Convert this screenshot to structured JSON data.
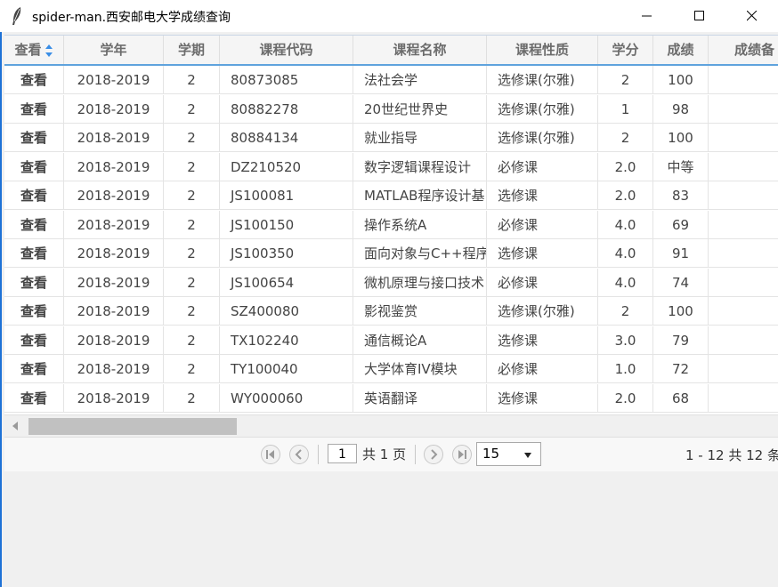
{
  "window": {
    "title": "spider-man.西安邮电大学成绩查询",
    "icon": "feather-icon"
  },
  "table": {
    "columns": [
      "查看",
      "学年",
      "学期",
      "课程代码",
      "课程名称",
      "课程性质",
      "学分",
      "成绩",
      "成绩备"
    ],
    "rows": [
      {
        "view": "查看",
        "year": "2018-2019",
        "term": "2",
        "code": "80873085",
        "name": "法社会学",
        "type": "选修课(尔雅)",
        "credit": "2",
        "score": "100"
      },
      {
        "view": "查看",
        "year": "2018-2019",
        "term": "2",
        "code": "80882278",
        "name": "20世纪世界史",
        "type": "选修课(尔雅)",
        "credit": "1",
        "score": "98"
      },
      {
        "view": "查看",
        "year": "2018-2019",
        "term": "2",
        "code": "80884134",
        "name": "就业指导",
        "type": "选修课(尔雅)",
        "credit": "2",
        "score": "100"
      },
      {
        "view": "查看",
        "year": "2018-2019",
        "term": "2",
        "code": "DZ210520",
        "name": "数字逻辑课程设计",
        "type": "必修课",
        "credit": "2.0",
        "score": "中等"
      },
      {
        "view": "查看",
        "year": "2018-2019",
        "term": "2",
        "code": "JS100081",
        "name": "MATLAB程序设计基",
        "type": "选修课",
        "credit": "2.0",
        "score": "83"
      },
      {
        "view": "查看",
        "year": "2018-2019",
        "term": "2",
        "code": "JS100150",
        "name": "操作系统A",
        "type": "必修课",
        "credit": "4.0",
        "score": "69"
      },
      {
        "view": "查看",
        "year": "2018-2019",
        "term": "2",
        "code": "JS100350",
        "name": "面向对象与C++程序",
        "type": "选修课",
        "credit": "4.0",
        "score": "91"
      },
      {
        "view": "查看",
        "year": "2018-2019",
        "term": "2",
        "code": "JS100654",
        "name": "微机原理与接口技术",
        "type": "必修课",
        "credit": "4.0",
        "score": "74"
      },
      {
        "view": "查看",
        "year": "2018-2019",
        "term": "2",
        "code": "SZ400080",
        "name": "影视鉴赏",
        "type": "选修课(尔雅)",
        "credit": "2",
        "score": "100"
      },
      {
        "view": "查看",
        "year": "2018-2019",
        "term": "2",
        "code": "TX102240",
        "name": "通信概论A",
        "type": "选修课",
        "credit": "3.0",
        "score": "79"
      },
      {
        "view": "查看",
        "year": "2018-2019",
        "term": "2",
        "code": "TY100040",
        "name": "大学体育IV模块",
        "type": "必修课",
        "credit": "1.0",
        "score": "72"
      },
      {
        "view": "查看",
        "year": "2018-2019",
        "term": "2",
        "code": "WY000060",
        "name": "英语翻译",
        "type": "选修课",
        "credit": "2.0",
        "score": "68"
      }
    ]
  },
  "pager": {
    "page": "1",
    "of_pages": "共 1 页",
    "page_size": "15",
    "info": "1 - 12  共 12 条"
  },
  "colors": {
    "link": "#1b6fbf",
    "header_border": "#5fa3dd",
    "window_border": "#1e72d6"
  }
}
